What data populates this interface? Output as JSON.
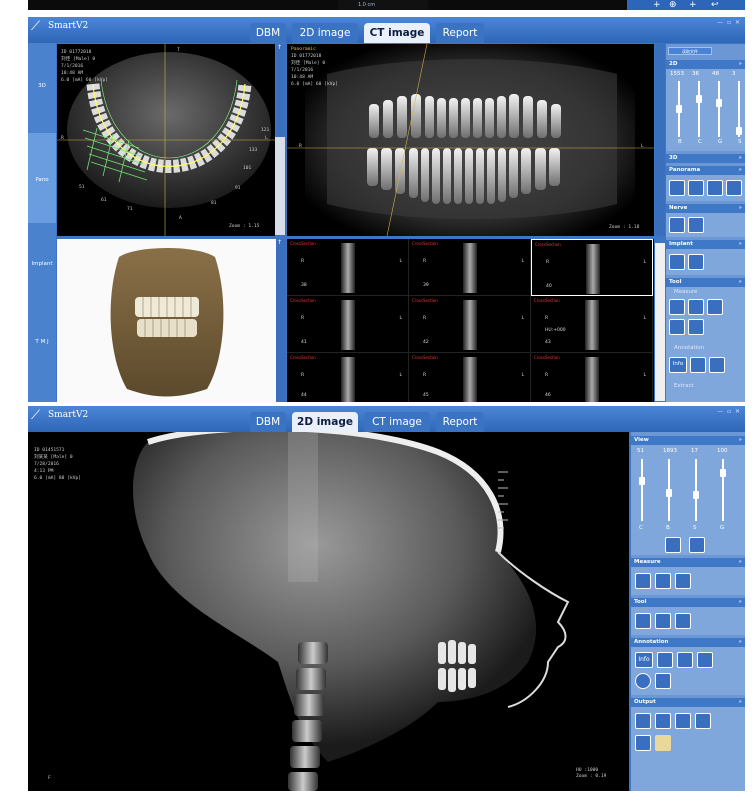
{
  "top_strip": {
    "mini_text": "1.0 cm"
  },
  "app": {
    "name": "SmartV2"
  },
  "tabs": [
    {
      "label": "DBM"
    },
    {
      "label": "2D image"
    },
    {
      "label": "CT image"
    },
    {
      "label": "Report"
    }
  ],
  "ct_view": {
    "active_tab": "CT image",
    "sidebar": [
      {
        "label": "3D"
      },
      {
        "label": "Pano"
      },
      {
        "label": "Implant"
      },
      {
        "label": "T M J"
      }
    ],
    "axial_info": [
      "ID 01772018",
      "刘佳 [Male] 0",
      "7/1/2016",
      "10:48 AM",
      "6.0 [mA] 60 [kVp]"
    ],
    "axial_zoom": "Zoom : 1.15",
    "axial_labels": {
      "r": "R",
      "l": "L",
      "a": "A",
      "n1": "51",
      "n2": "91",
      "n3": "101",
      "n4": "121",
      "n5": "133",
      "n6": "61",
      "n7": "71",
      "n8": "81",
      "top": "T"
    },
    "pano_info": [
      "Panoramic",
      "ID 01772018",
      "刘佳 [Male] 0",
      "7/1/2016",
      "10:48 AM",
      "6.0 [mA] 60 [kVp]"
    ],
    "pano_zoom": "Zoom : 1.18",
    "pano_r": "R",
    "pano_l": "L",
    "cross_label": "CrossSection",
    "cross_values": [
      "38",
      "39",
      "40",
      "41",
      "42",
      "43",
      "44",
      "45",
      "46"
    ],
    "cross_extra": "HU:+000",
    "right_panel": {
      "button": "读取文件",
      "sec_2d": "2D",
      "slider_values": [
        "1553",
        "36",
        "48",
        "3"
      ],
      "slider_labels": [
        "B",
        "C",
        "G",
        "S"
      ],
      "sec_3d": "3D",
      "sec_panorama": "Panorama",
      "sec_nerve": "Nerve",
      "sec_implant": "Implant",
      "sec_tool": "Tool",
      "sub_measure": "Measure",
      "sub_annotation": "Annotation",
      "sub_extra": "Extract",
      "info_label": "Info"
    }
  },
  "twod_view": {
    "active_tab": "2D image",
    "xray_info": [
      "ID 01451571",
      "刘某某 [Male] 0",
      "7/28/2016",
      "4:13 PM",
      "6.0 [mA] 80 [kVp]"
    ],
    "xray_corner": "F",
    "xray_zoom": "HU :1000\nZoom : 0.19",
    "right_panel": {
      "sec_view": "View",
      "slider_values": [
        "51",
        "1893",
        "17",
        "100"
      ],
      "slider_labels": [
        "C",
        "B",
        "S",
        "G"
      ],
      "sec_measure": "Measure",
      "sec_tool": "Tool",
      "sec_annotation": "Annotation",
      "info_label": "Info",
      "sec_output": "Output"
    }
  },
  "colors": {
    "brand": "#3e76c4",
    "panel": "#6b98d4",
    "tab_active": "#e9f0fa"
  }
}
